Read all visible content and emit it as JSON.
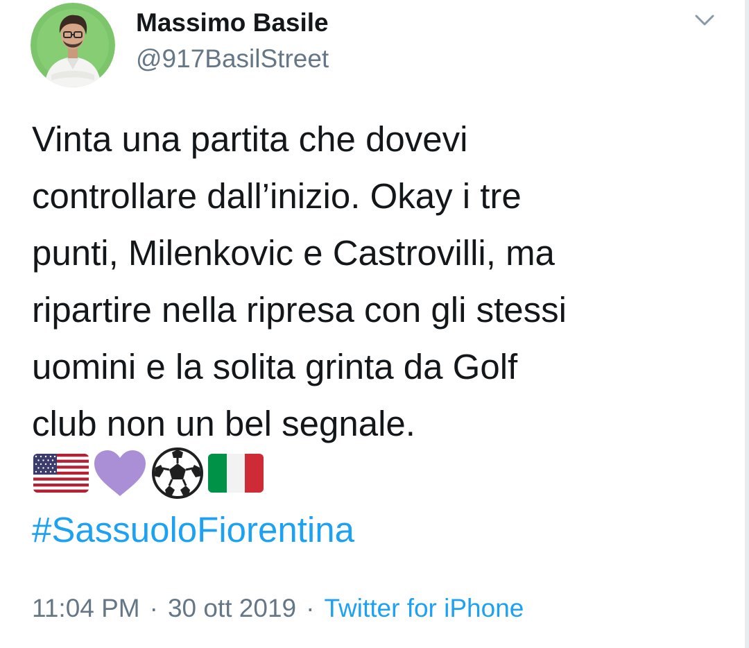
{
  "author": {
    "name": "Massimo Basile",
    "handle": "@917BasilStreet",
    "avatar_icon": "profile-photo"
  },
  "tweet": {
    "text": "Vinta una partita che dovevi\ncontrollare dall’inizio. Okay i tre\npunti, Milenkovic e Castrovilli, ma\nripartire nella ripresa con gli stessi\nuomini e la solita grinta da Golf\nclub non un bel segnale.",
    "emojis": [
      "us-flag-emoji",
      "purple-heart-emoji",
      "soccer-ball-emoji",
      "italy-flag-emoji"
    ],
    "hashtag": "#SassuoloFiorentina"
  },
  "meta": {
    "time": "11:04 PM",
    "separator": "·",
    "date": "30 ott 2019",
    "source": "Twitter for iPhone"
  },
  "menu": {
    "icon": "chevron-down-icon"
  },
  "colors": {
    "link": "#1da1f2",
    "secondary_text": "#657786",
    "primary_text": "#14171a",
    "avatar_bg": "#7cc56a",
    "heart": "#aa8ed6"
  }
}
